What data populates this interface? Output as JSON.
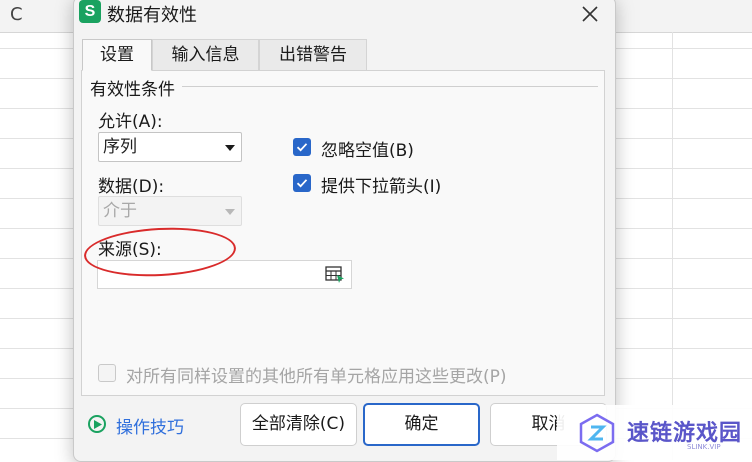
{
  "spreadsheet": {
    "column_letter": "C"
  },
  "dialog": {
    "app_logo": "S",
    "title": "数据有效性",
    "tabs": [
      "设置",
      "输入信息",
      "出错警告"
    ],
    "section_title": "有效性条件",
    "allow": {
      "label": "允许(A):",
      "value": "序列"
    },
    "data": {
      "label": "数据(D):",
      "value": "介于"
    },
    "ignore_blank": {
      "label": "忽略空值(B)",
      "checked": true
    },
    "dropdown_arrow": {
      "label": "提供下拉箭头(I)",
      "checked": true
    },
    "source": {
      "label": "来源(S):",
      "value": ""
    },
    "apply_all": {
      "label": "对所有同样设置的其他所有单元格应用这些更改(P)",
      "checked": false
    },
    "tips_link": "操作技巧",
    "buttons": {
      "clear_all": "全部清除(C)",
      "ok": "确定",
      "cancel": "取消"
    }
  },
  "watermark": {
    "text": "速链游戏园",
    "sub": "SLINK.VIP"
  },
  "colors": {
    "accent": "#2967c9",
    "brand_green": "#1aa260",
    "annotation_red": "#d92b2b"
  }
}
